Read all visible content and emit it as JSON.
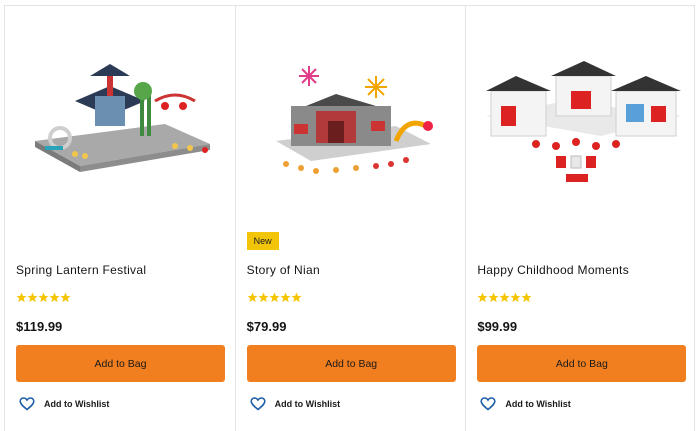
{
  "products": [
    {
      "title": "Spring Lantern Festival",
      "rating_stars": 5,
      "price": "$119.99",
      "add_to_bag": "Add to Bag",
      "wishlist": "Add to Wishlist",
      "badge": ""
    },
    {
      "title": "Story of Nian",
      "rating_stars": 5,
      "price": "$79.99",
      "add_to_bag": "Add to Bag",
      "wishlist": "Add to Wishlist",
      "badge": "New"
    },
    {
      "title": "Happy Childhood Moments",
      "rating_stars": 5,
      "price": "$99.99",
      "add_to_bag": "Add to Bag",
      "wishlist": "Add to Wishlist",
      "badge": ""
    }
  ],
  "colors": {
    "button": "#f27f1f",
    "star": "#f5c400",
    "badge": "#f2c40a",
    "heart": "#1c5fa8"
  },
  "icons": {
    "star": "star-icon",
    "wishlist": "heart-icon"
  }
}
